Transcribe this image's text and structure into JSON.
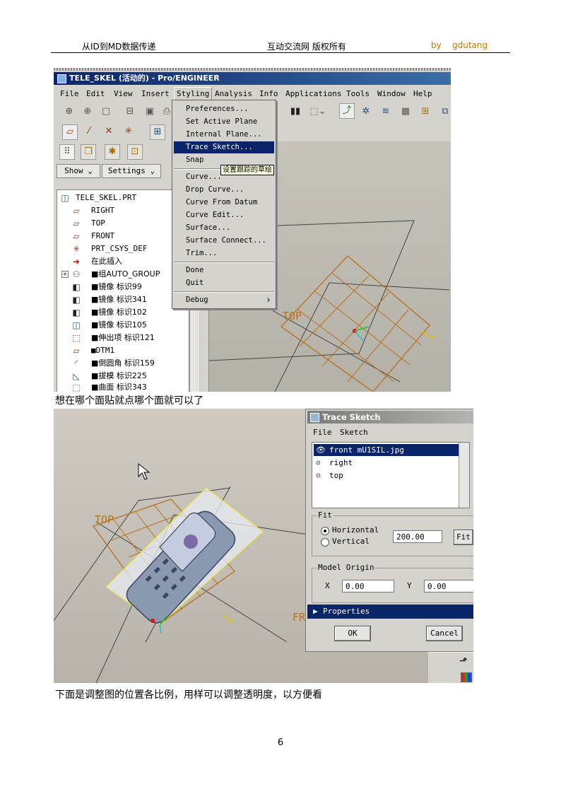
{
  "header": {
    "left": "从ID到MD数据传递",
    "center": "互动交流网 版权所有",
    "by": "by",
    "author": "gdutang",
    "author_color": "#c87800"
  },
  "screenshot1": {
    "window_title": "TELE_SKEL (活动的) - Pro/ENGINEER",
    "menubar": [
      "File",
      "Edit",
      "View",
      "Insert",
      "Styling",
      "Analysis",
      "Info",
      "Applications",
      "Tools",
      "Window",
      "Help"
    ],
    "styling_menu": {
      "items": [
        "Preferences...",
        "Set Active Plane",
        "Internal Plane...",
        "Trace Sketch...",
        "Snap",
        "Curve...",
        "Drop Curve...",
        "Curve From Datum",
        "Curve Edit...",
        "Surface...",
        "Surface Connect...",
        "Trim...",
        "Done",
        "Quit",
        "Debug"
      ],
      "selected": "Trace Sketch...",
      "submenu_arrow": "›"
    },
    "tooltip": "设置跟踪的草绘",
    "show_button": "Show ⌄",
    "settings_button": "Settings ⌄",
    "tree": [
      {
        "icon": "part-icon",
        "glyph": "◫",
        "label": "TELE_SKEL.PRT"
      },
      {
        "icon": "datum-plane-icon",
        "glyph": "▱",
        "label": "RIGHT"
      },
      {
        "icon": "datum-plane-icon",
        "glyph": "▱",
        "label": "TOP"
      },
      {
        "icon": "datum-plane-icon",
        "glyph": "▱",
        "label": "FRONT"
      },
      {
        "icon": "csys-icon",
        "glyph": "✳",
        "label": "PRT_CSYS_DEF"
      },
      {
        "icon": "insert-here-icon",
        "glyph": "➜",
        "label": "在此插入"
      },
      {
        "icon": "group-icon",
        "glyph": "⚇",
        "label": "■组AUTO_GROUP"
      },
      {
        "icon": "mirror-icon",
        "glyph": "◧",
        "label": "■镜像 标识99"
      },
      {
        "icon": "mirror-icon",
        "glyph": "◧",
        "label": "■镜像 标识341"
      },
      {
        "icon": "mirror-icon",
        "glyph": "◧",
        "label": "■镜像 标识102"
      },
      {
        "icon": "mirror-icon",
        "glyph": "◫",
        "label": "■镜像 标识105"
      },
      {
        "icon": "extrude-icon",
        "glyph": "⬚",
        "label": "■伸出项 标识121"
      },
      {
        "icon": "datum-plane-icon",
        "glyph": "▱",
        "label": "■DTM1"
      },
      {
        "icon": "round-icon",
        "glyph": "◜",
        "label": "■倒圆角 标识159"
      },
      {
        "icon": "draft-icon",
        "glyph": "◺",
        "label": "■拔模 标识225"
      },
      {
        "icon": "surface-icon",
        "glyph": "⬚",
        "label": "■曲面 标识343"
      }
    ],
    "view_label": "TOP"
  },
  "text1": "想在哪个面贴就点哪个面就可以了",
  "screenshot2": {
    "dialog_title": "Trace Sketch",
    "menu": [
      "File",
      "Sketch"
    ],
    "list_items": [
      {
        "label": "front  mU1SIL.jpg",
        "selected": true
      },
      {
        "label": "right",
        "selected": false
      },
      {
        "label": "top",
        "selected": false
      }
    ],
    "fit_label": "Fit",
    "horizontal_label": "Horizontal",
    "vertical_label": "Vertical",
    "fit_value": "200.00",
    "fit_button": "Fit",
    "model_origin_label": "Model Origin",
    "x_label": "X",
    "x_value": "0.00",
    "y_label": "Y",
    "y_value": "0.00",
    "properties_label": "Properties",
    "ok_button": "OK",
    "cancel_button": "Cancel",
    "view_top_label": "TOP",
    "view_front_label": "FR"
  },
  "text2": "下面是调整图的位置各比例，用样可以调整透明度，以方便看",
  "page_number": "6"
}
